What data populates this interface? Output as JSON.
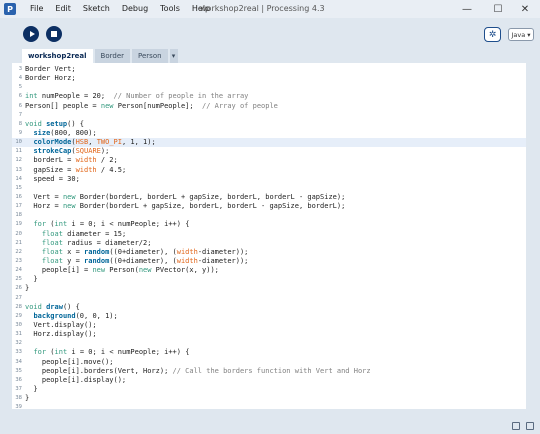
{
  "app": {
    "icon": "processing-logo-icon",
    "window_title": "workshop2real | Processing 4.3",
    "menu": [
      "File",
      "Edit",
      "Sketch",
      "Debug",
      "Tools",
      "Help"
    ],
    "window_controls": [
      "minimize-icon",
      "maximize-icon",
      "close-icon"
    ]
  },
  "toolbar": {
    "run_icon": "play-icon",
    "stop_icon": "stop-icon",
    "debug_icon": "debugger-icon",
    "mode_label": "Java ▾"
  },
  "tabs": [
    {
      "label": "workshop2real",
      "active": true
    },
    {
      "label": "Border",
      "active": false
    },
    {
      "label": "Person",
      "active": false
    }
  ],
  "tab_more_label": "▾",
  "editor": {
    "current_line": 10,
    "lines": [
      {
        "n": "3",
        "code": "Border Vert;"
      },
      {
        "n": "4",
        "code": "Border Horz;"
      },
      {
        "n": "5",
        "code": ""
      },
      {
        "n": "6",
        "code": "int numPeople = 20;  // Number of people in the array"
      },
      {
        "n": "6",
        "code": "Person[] people = new Person[numPeople];  // Array of people"
      },
      {
        "n": "7",
        "code": ""
      },
      {
        "n": "8",
        "code": "void setup() {"
      },
      {
        "n": "9",
        "code": "  size(800, 800);"
      },
      {
        "n": "10",
        "code": "  colorMode(HSB, TWO_PI, 1, 1);"
      },
      {
        "n": "11",
        "code": "  strokeCap(SQUARE);"
      },
      {
        "n": "12",
        "code": "  borderL = width / 2;"
      },
      {
        "n": "13",
        "code": "  gapSize = width / 4.5;"
      },
      {
        "n": "14",
        "code": "  speed = 30;"
      },
      {
        "n": "15",
        "code": ""
      },
      {
        "n": "16",
        "code": "  Vert = new Border(borderL, borderL + gapSize, borderL, borderL - gapSize);"
      },
      {
        "n": "17",
        "code": "  Horz = new Border(borderL + gapSize, borderL, borderL - gapSize, borderL);"
      },
      {
        "n": "18",
        "code": ""
      },
      {
        "n": "19",
        "code": "  for (int i = 0; i < numPeople; i++) {"
      },
      {
        "n": "20",
        "code": "    float diameter = 15;"
      },
      {
        "n": "21",
        "code": "    float radius = diameter/2;"
      },
      {
        "n": "22",
        "code": "    float x = random((0+diameter), (width-diameter));"
      },
      {
        "n": "23",
        "code": "    float y = random((0+diameter), (width-diameter));"
      },
      {
        "n": "24",
        "code": "    people[i] = new Person(new PVector(x, y));"
      },
      {
        "n": "25",
        "code": "  }"
      },
      {
        "n": "26",
        "code": "}"
      },
      {
        "n": "27",
        "code": ""
      },
      {
        "n": "28",
        "code": "void draw() {"
      },
      {
        "n": "29",
        "code": "  background(0, 0, 1);"
      },
      {
        "n": "30",
        "code": "  Vert.display();"
      },
      {
        "n": "31",
        "code": "  Horz.display();"
      },
      {
        "n": "32",
        "code": ""
      },
      {
        "n": "33",
        "code": "  for (int i = 0; i < numPeople; i++) {"
      },
      {
        "n": "34",
        "code": "    people[i].move();"
      },
      {
        "n": "35",
        "code": "    people[i].borders(Vert, Horz); // Call the borders function with Vert and Horz"
      },
      {
        "n": "36",
        "code": "    people[i].display();"
      },
      {
        "n": "37",
        "code": "  }"
      },
      {
        "n": "38",
        "code": "}"
      },
      {
        "n": "39",
        "code": ""
      }
    ]
  },
  "status": {
    "icons": [
      "console-icon",
      "errors-icon"
    ]
  }
}
